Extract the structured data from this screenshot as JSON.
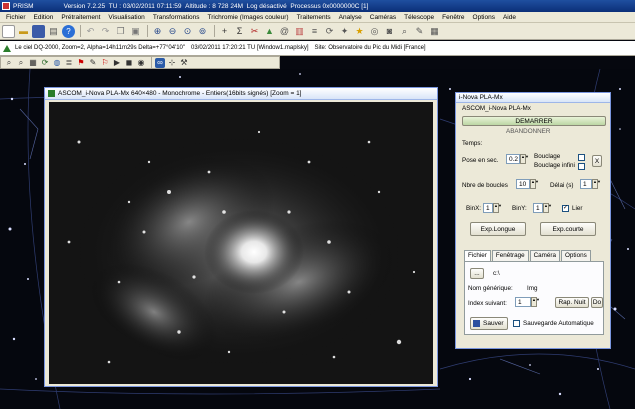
{
  "app": {
    "name": "PRISM",
    "version": "Version 7.2.25",
    "tu": "TU : 03/02/2011 07:11:59",
    "altitude": "Altitude : 8 728 24M",
    "mode": "Log désactivé",
    "process": "Processus 0x0000000C [1]"
  },
  "menu": [
    "Fichier",
    "Edition",
    "Prétraitement",
    "Visualisation",
    "Transformations",
    "Trichromie (Images couleur)",
    "Traitements",
    "Analyse",
    "Caméras",
    "Télescope",
    "Fenêtre",
    "Options",
    "Aide"
  ],
  "infobar": {
    "sky": "Le ciel DQ-2000, Zoom=2, Alpha=14h11m29s Delta=+77°04'10\"",
    "datetime": "03/02/2011 17:20:21 TU [Window1.maplsky]",
    "site": "Site: Observatoire du Pic du Midi [France]"
  },
  "image_window": {
    "title": "ASCOM_i-Nova PLA-Mx 640×480 - Monochrome - Entiers(16bits signés) [Zoom = 1]"
  },
  "panel": {
    "title": "i-Nova PLA-Mx",
    "device": "ASCOM_i-Nova PLA-Mx",
    "start": "DEMARRER",
    "abandon": "ABANDONNER",
    "temps_label": "Temps:",
    "pose_label": "Pose en sec.",
    "pose_value": "0.2",
    "bouclage": "Bouclage",
    "bouclage_infini": "Bouclage infini",
    "x_label": "X",
    "nb_boucles_label": "Nbre de boucles",
    "nb_boucles_value": "10",
    "delai_label": "Délai (s)",
    "delai_value": "1",
    "binx_label": "BinX:",
    "binx_value": "1",
    "biny_label": "BinY:",
    "biny_value": "1",
    "lier_label": "Lier",
    "exp_longue": "Exp.Longue",
    "exp_courte": "Exp.courte",
    "tabs": [
      "Fichier",
      "Fenêtrage",
      "Caméra",
      "Options"
    ],
    "browse": "...",
    "path": "c:\\",
    "nom_generique": "Nom générique:",
    "nom_value": "Img",
    "index_label": "Index suivant:",
    "index_value": "1",
    "rap_nuit": "Rap. Nuit",
    "do_label": "Do",
    "sauver": "Sauver",
    "sauvegarde_auto": "Sauvegarde Automatique"
  },
  "icons": {
    "toolbar1": [
      "new-file-icon",
      "open-icon",
      "save-icon",
      "print-icon",
      "help-icon",
      "undo-icon",
      "redo-icon",
      "copy-icon",
      "paste-icon",
      "zoom-in-icon",
      "zoom-out-icon",
      "crosshair-icon",
      "sum-icon",
      "cut-icon",
      "triangle-icon",
      "spiral-icon",
      "chart-icon"
    ],
    "toolbar2": [
      "magnifier-icon",
      "zoom-fit-icon",
      "grid-icon",
      "refresh-icon",
      "marker-icon",
      "play-icon",
      "binoculars-icon",
      "scope-icon"
    ]
  }
}
